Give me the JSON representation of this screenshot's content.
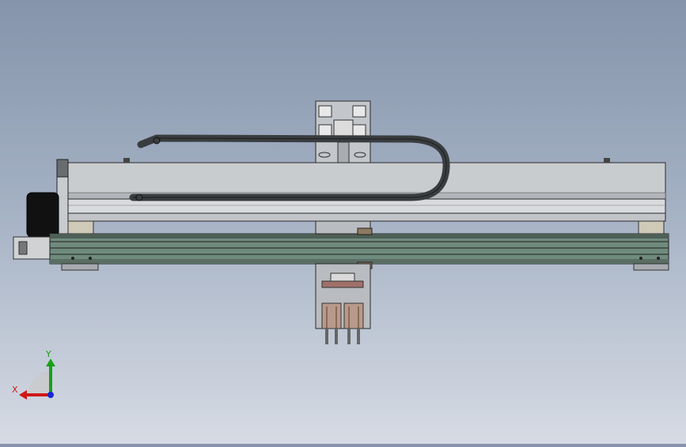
{
  "viewport": {
    "background_top": "#8594ab",
    "background_bottom": "#d6dbe4"
  },
  "triad": {
    "x_label": "X",
    "y_label": "Y",
    "x_color": "#d01818",
    "y_color": "#18a018",
    "z_color": "#1828d0"
  },
  "model": {
    "beam_color": "#c9cccf",
    "rail_color": "#6f8b7e",
    "chain_color": "#3a3d40",
    "motor_color": "#111111",
    "carriage_color": "#b9bcc0"
  }
}
